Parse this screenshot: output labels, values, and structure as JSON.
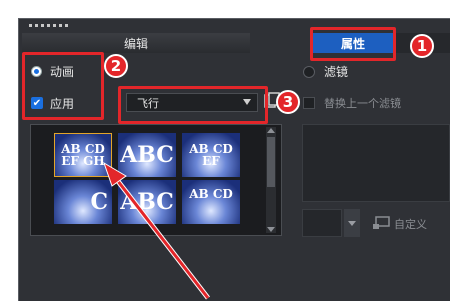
{
  "tabs": {
    "edit": "编辑",
    "attributes": "属性"
  },
  "options": {
    "animation_label": "动画",
    "apply_label": "应用",
    "filter_label": "滤镜",
    "replace_filter_label": "替换上一个滤镜",
    "custom_label": "自定义"
  },
  "dropdown": {
    "selected": "飞行"
  },
  "badges": [
    "1",
    "2",
    "3"
  ],
  "thumbnails": [
    {
      "text": "AB CD EF GH"
    },
    {
      "text": "ABC"
    },
    {
      "text": "AB CD EF"
    },
    {
      "text": "C"
    },
    {
      "text": "ABC"
    },
    {
      "text": "AB CD"
    }
  ],
  "colors": {
    "accent": "#1d5fc0",
    "highlight": "#e3262a",
    "panel": "#2f3136"
  }
}
